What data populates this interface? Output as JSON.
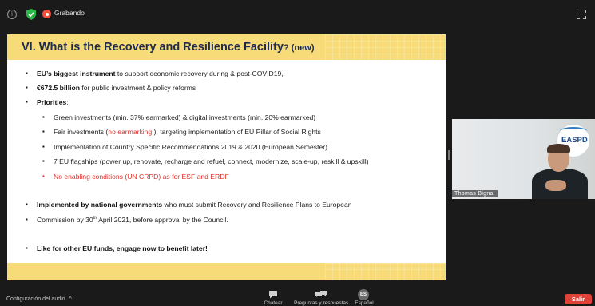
{
  "topbar": {
    "recording_label": "Grabando"
  },
  "slide": {
    "title": "VI. What is the Recovery and Resilience Facility",
    "title_suffix": "? (new)",
    "bullets": [
      {
        "bold": "EU’s biggest instrument",
        "text": " to support economic recovery during & post-COVID19,"
      },
      {
        "bold": "€672.5 billion",
        "text": " for public investment & policy reforms"
      },
      {
        "bold": "Priorities",
        "text": ":"
      }
    ],
    "sub_bullets": [
      {
        "text": "Green investments (min. 37% earmarked) & digital investments (min. 20% earmarked)"
      },
      {
        "pre": "Fair investments (",
        "red": "no earmarking!",
        "post": "), targeting implementation of EU Pillar of Social Rights"
      },
      {
        "text": "Implementation of Country Specific Recommendations 2019 & 2020 (European Semester)"
      },
      {
        "text": "7 EU flagships (power up, renovate, recharge and refuel, connect, modernize, scale-up, reskill & upskill)"
      },
      {
        "text": "No enabling conditions (UN CRPD) as for ESF and ERDF"
      }
    ],
    "implemented": {
      "bold": "Implemented by national governments",
      "line1_rest": " who must submit Recovery and Resilience Plans to European",
      "line2_pre": "Commission by 30",
      "line2_sup": "th",
      "line2_post": " April 2021, before approval by the Council."
    },
    "last_bullet": "Like for other EU funds, engage now to benefit later!"
  },
  "video": {
    "participant_name": "Thomas Bignal",
    "logo_text": "EASPD"
  },
  "toolbar": {
    "audio_settings": "Configuración del audio",
    "chat": "Chatear",
    "qa": "Preguntas y respuestas",
    "language": "Español",
    "language_badge": "ES",
    "leave": "Salir"
  },
  "colors": {
    "title_band": "#f6db78",
    "title_text": "#1f2b4a",
    "alert_red": "#e0302a",
    "leave_red": "#e0423a"
  }
}
